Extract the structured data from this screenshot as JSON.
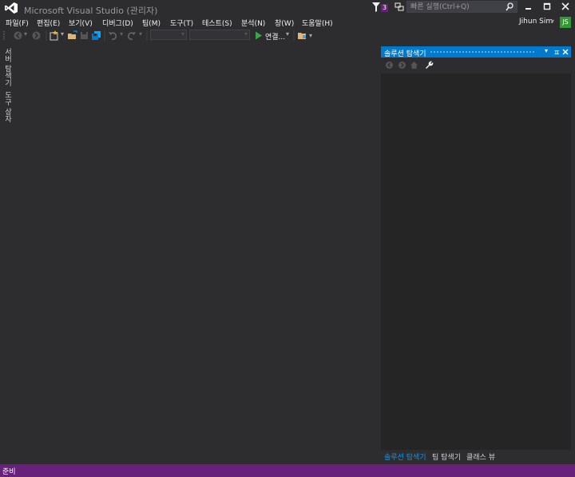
{
  "title_bar": {
    "app_title": "Microsoft Visual Studio (관리자)",
    "notification_count": "3",
    "quick_launch_placeholder": "빠른 실행(Ctrl+Q)"
  },
  "menu": [
    {
      "label": "파일(F)"
    },
    {
      "label": "편집(E)"
    },
    {
      "label": "보기(V)"
    },
    {
      "label": "디버그(D)"
    },
    {
      "label": "팀(M)"
    },
    {
      "label": "도구(T)"
    },
    {
      "label": "테스트(S)"
    },
    {
      "label": "분석(N)"
    },
    {
      "label": "창(W)"
    },
    {
      "label": "도움말(H)"
    }
  ],
  "user": {
    "name": "Jihun Sim",
    "initials": "JS"
  },
  "toolbar": {
    "connect_label": "연결..."
  },
  "left_tabs": [
    {
      "label": "서버 탐색기"
    },
    {
      "label": "도구 상자"
    }
  ],
  "solution_explorer": {
    "title": "솔루션 탐색기",
    "pin_glyph": "ㅍ",
    "tabs": [
      {
        "label": "솔루션 탐색기",
        "active": true
      },
      {
        "label": "팀 탐색기",
        "active": false
      },
      {
        "label": "클래스 뷰",
        "active": false
      }
    ]
  },
  "status_bar": {
    "text": "준비"
  },
  "colors": {
    "accent": "#007acc",
    "status_bar": "#68217a",
    "avatar": "#339933",
    "background": "#2d2d30"
  }
}
